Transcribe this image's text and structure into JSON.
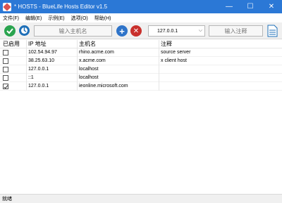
{
  "window": {
    "title": "* HOSTS - BlueLife Hosts Editor v1.5",
    "minimize": "—",
    "maximize": "☐",
    "close": "✕"
  },
  "menu": [
    {
      "label": "文件(F)"
    },
    {
      "label": "编辑(E)"
    },
    {
      "label": "示例(E)"
    },
    {
      "label": "选项(O)"
    },
    {
      "label": "帮助(H)"
    }
  ],
  "toolbar": {
    "hostname_placeholder": "输入主机名",
    "ip_value": "127.0.0.1",
    "note_placeholder": "输入注释",
    "colors": {
      "confirm": "#2aa44f",
      "add": "#2f74c9",
      "delete": "#c9302c"
    }
  },
  "table": {
    "headers": {
      "enabled": "已启用",
      "ip": "IP 地址",
      "host": "主机名",
      "note": "注释"
    },
    "rows": [
      {
        "enabled": false,
        "ip": "102.54.94.97",
        "host": "rhino.acme.com",
        "note": "source server"
      },
      {
        "enabled": false,
        "ip": "38.25.63.10",
        "host": "x.acme.com",
        "note": "x client host"
      },
      {
        "enabled": false,
        "ip": "127.0.0.1",
        "host": "localhost",
        "note": ""
      },
      {
        "enabled": false,
        "ip": "::1",
        "host": "localhost",
        "note": ""
      },
      {
        "enabled": true,
        "ip": "127.0.0.1",
        "host": "ieonline.microsoft.com",
        "note": ""
      }
    ]
  },
  "status": {
    "text": "就绪"
  }
}
